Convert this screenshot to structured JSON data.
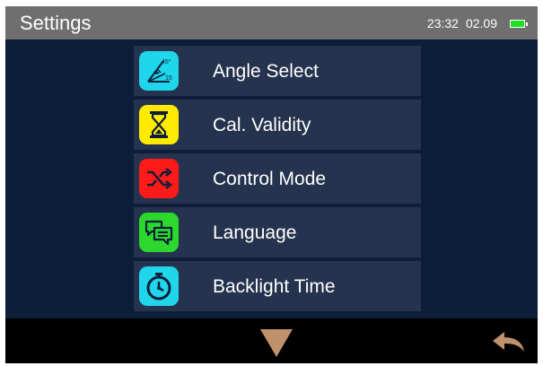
{
  "header": {
    "title": "Settings",
    "time": "23:32",
    "date": "02.09",
    "battery_icon": "battery-full-icon",
    "colors": {
      "bar": "#6f6f6f",
      "battery": "#1fe01f"
    }
  },
  "menu": {
    "items": [
      {
        "label": "Angle Select",
        "icon": "angle-select-icon",
        "icon_color": "#1fd6ea"
      },
      {
        "label": "Cal. Validity",
        "icon": "hourglass-icon",
        "icon_color": "#ffea00"
      },
      {
        "label": "Control Mode",
        "icon": "shuffle-icon",
        "icon_color": "#ff1a1a"
      },
      {
        "label": "Language",
        "icon": "chat-bubbles-icon",
        "icon_color": "#2bd82b"
      },
      {
        "label": "Backlight Time",
        "icon": "stopwatch-icon",
        "icon_color": "#1fd6ea"
      }
    ]
  },
  "footer": {
    "down_icon": "arrow-down-icon",
    "back_icon": "back-arrow-icon",
    "accent": "#c0916a"
  },
  "theme": {
    "background": "#0d1e3b",
    "item_bg": "#25334e"
  }
}
